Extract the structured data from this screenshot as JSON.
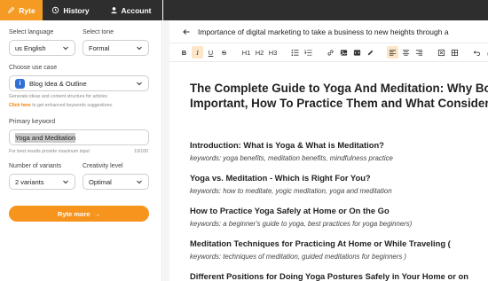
{
  "nav": {
    "tabs": [
      {
        "label": "Ryte",
        "icon": "pen-icon"
      },
      {
        "label": "History",
        "icon": "history-icon"
      },
      {
        "label": "Account",
        "icon": "user-icon"
      }
    ]
  },
  "form": {
    "language_label": "Select language",
    "language_value": "us English",
    "tone_label": "Select tone",
    "tone_value": "Formal",
    "usecase_label": "Choose use case",
    "usecase_value": "Blog Idea & Outline",
    "usecase_icon_text": "i",
    "usecase_hint": "Generate ideas and content structure for articles",
    "hint_link": "Click here",
    "hint_rest": " to get enhanced keywords suggestions.",
    "keyword_label": "Primary keyword",
    "keyword_value": "Yoga and Meditation",
    "keyword_hint": "For best results provide maximum input",
    "keyword_count": "19/100",
    "variants_label": "Number of variants",
    "variants_value": "2 variants",
    "creativity_label": "Creativity level",
    "creativity_value": "Optimal",
    "submit_label": "Ryte more",
    "submit_arrow": "→"
  },
  "editor": {
    "doc_title": "Importance of digital marketing to take a business to new heights through a",
    "toolbar": {
      "bold": "B",
      "italic": "I",
      "underline": "U",
      "strike": "S",
      "h1": "H1",
      "h2": "H2",
      "h3": "H3"
    },
    "heading": "The Complete Guide to Yoga And Meditation: Why Both Important, How To Practice Them and What Consider",
    "sections": [
      {
        "title": "Introduction: What is Yoga & What is Meditation?",
        "keywords": "keywords: yoga benefits, meditation benefits, mindfulness practice"
      },
      {
        "title": "Yoga vs. Meditation - Which is Right For You?",
        "keywords": "keywords: how to meditate, yogic meditation, yoga and meditation"
      },
      {
        "title": "How to Practice Yoga Safely at Home or On the Go",
        "keywords": "keywords: a beginner's guide to yoga, best practices for yoga beginners)"
      },
      {
        "title": "Meditation Techniques for Practicing At Home or While Traveling (",
        "keywords": "keywords: techniques of meditation, guided meditations for beginners )"
      },
      {
        "title": "Different Positions for Doing Yoga Postures Safely in Your Home or on",
        "keywords": ""
      }
    ]
  },
  "colors": {
    "accent": "#f7941d",
    "nav_bg": "#2e2e2e",
    "usecase_icon": "#2f6fd6"
  }
}
